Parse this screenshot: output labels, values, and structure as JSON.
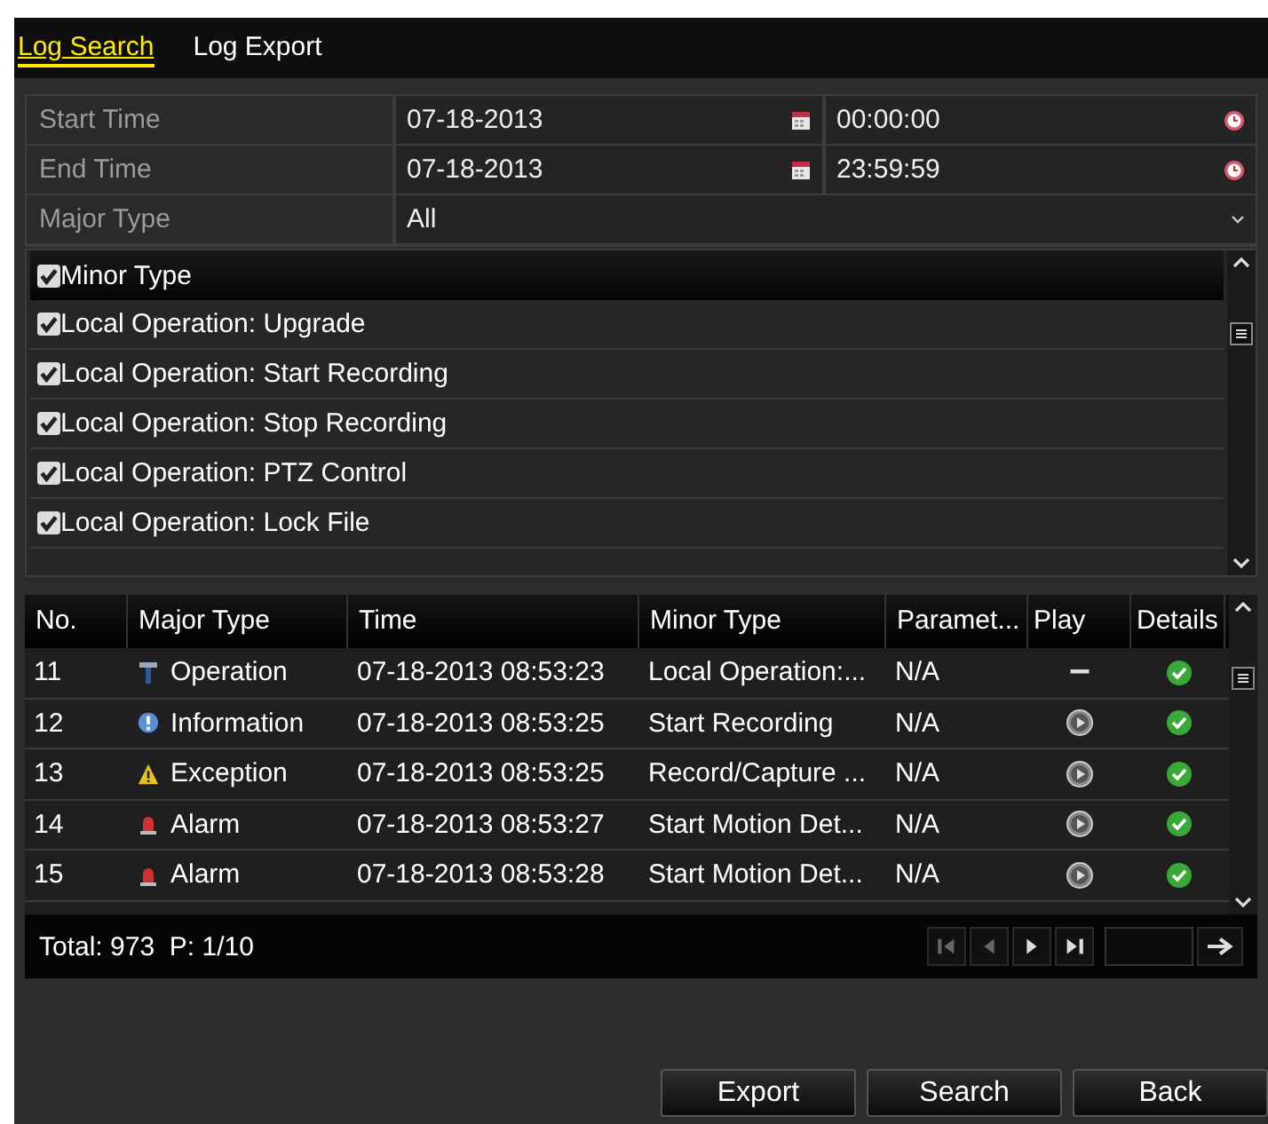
{
  "tabs": [
    {
      "label": "Log Search",
      "selected": true
    },
    {
      "label": "Log Export",
      "selected": false
    }
  ],
  "form": {
    "start_time": {
      "label": "Start Time",
      "date": "07-18-2013",
      "time": "00:00:00"
    },
    "end_time": {
      "label": "End Time",
      "date": "07-18-2013",
      "time": "23:59:59"
    },
    "major_type": {
      "label": "Major Type",
      "value": "All"
    }
  },
  "minor_types": {
    "header": {
      "label": "Minor Type",
      "checked": true
    },
    "items": [
      {
        "label": "Local Operation: Upgrade",
        "checked": true
      },
      {
        "label": "Local Operation: Start Recording",
        "checked": true
      },
      {
        "label": "Local Operation: Stop Recording",
        "checked": true
      },
      {
        "label": "Local Operation: PTZ Control",
        "checked": true
      },
      {
        "label": "Local Operation: Lock File",
        "checked": true
      }
    ]
  },
  "table": {
    "columns": [
      "No.",
      "Major Type",
      "Time",
      "Minor Type",
      "Paramet...",
      "Play",
      "Details"
    ],
    "rows": [
      {
        "no": "11",
        "kind": "operation",
        "major": "Operation",
        "time": "07-18-2013 08:53:23",
        "minor": "Local Operation:...",
        "param": "N/A",
        "playable": false
      },
      {
        "no": "12",
        "kind": "information",
        "major": "Information",
        "time": "07-18-2013 08:53:25",
        "minor": "Start Recording",
        "param": "N/A",
        "playable": true
      },
      {
        "no": "13",
        "kind": "exception",
        "major": "Exception",
        "time": "07-18-2013 08:53:25",
        "minor": "Record/Capture ...",
        "param": "N/A",
        "playable": true
      },
      {
        "no": "14",
        "kind": "alarm",
        "major": "Alarm",
        "time": "07-18-2013 08:53:27",
        "minor": "Start Motion Det...",
        "param": "N/A",
        "playable": true
      },
      {
        "no": "15",
        "kind": "alarm",
        "major": "Alarm",
        "time": "07-18-2013 08:53:28",
        "minor": "Start Motion Det...",
        "param": "N/A",
        "playable": true
      }
    ]
  },
  "footer": {
    "total": "Total: 973  P: 1/10"
  },
  "buttons": [
    "Export",
    "Search",
    "Back"
  ]
}
